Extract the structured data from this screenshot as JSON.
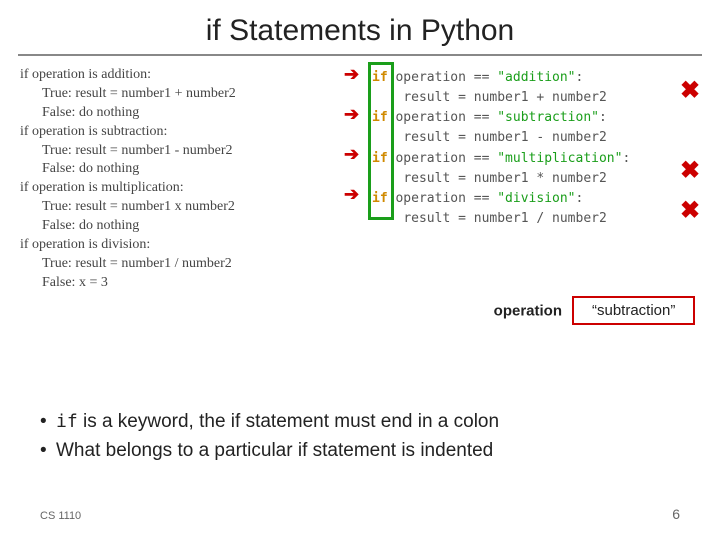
{
  "title": "if Statements in Python",
  "pseudo": {
    "l1": "if operation is addition:",
    "l2": "True: result = number1 + number2",
    "l3": "False: do nothing",
    "l4": "if operation is subtraction:",
    "l5": "True: result = number1 - number2",
    "l6": "False: do nothing",
    "l7": "if operation is multiplication:",
    "l8": "True: result = number1 x number2",
    "l9": "False: do nothing",
    "l10": "if operation is division:",
    "l11": "True: result = number1 / number2",
    "l12": "False: x = 3"
  },
  "code": {
    "kw": "if",
    "op": "operation ==",
    "s1": "\"addition\"",
    "s2": "\"subtraction\"",
    "s3": "\"multiplication\"",
    "s4": "\"division\"",
    "colon": ":",
    "r1": "result = number1 + number2",
    "r2": "result = number1 - number2",
    "r3": "result = number1 * number2",
    "r4": "result = number1 / number2"
  },
  "var": {
    "name": "operation",
    "value": "“subtraction”"
  },
  "bullets": {
    "b1a": "if",
    "b1b": " is a keyword, the if statement must end in a colon",
    "b2": "What belongs to a particular if statement is indented"
  },
  "footer": {
    "left": "CS 1110",
    "right": "6"
  },
  "glyphs": {
    "arrow": "➔",
    "ast": "✖",
    "bullet": "•"
  }
}
